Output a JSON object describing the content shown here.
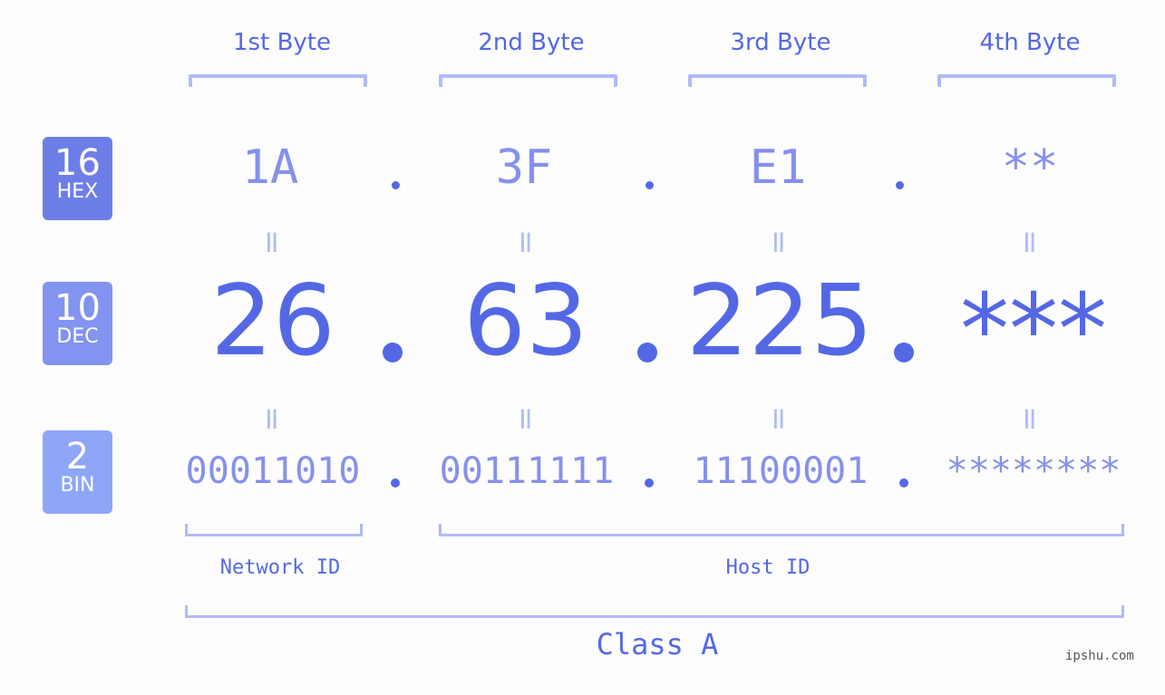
{
  "bytes": [
    {
      "label": "1st Byte",
      "hex": "1A",
      "dec": "26",
      "bin": "00011010"
    },
    {
      "label": "2nd Byte",
      "hex": "3F",
      "dec": "63",
      "bin": "00111111"
    },
    {
      "label": "3rd Byte",
      "hex": "E1",
      "dec": "225",
      "bin": "11100001"
    },
    {
      "label": "4th Byte",
      "hex": "**",
      "dec": "***",
      "bin": "********"
    }
  ],
  "badges": {
    "hex": {
      "num": "16",
      "unit": "HEX",
      "color": "#6e7ee9"
    },
    "dec": {
      "num": "10",
      "unit": "DEC",
      "color": "#8293f0"
    },
    "bin": {
      "num": "2",
      "unit": "BIN",
      "color": "#8ea6f8"
    }
  },
  "equals_symbol": "=",
  "network_id_label": "Network ID",
  "host_id_label": "Host ID",
  "class_label": "Class A",
  "watermark": "ipshu.com",
  "colors": {
    "primary": "#5468e6",
    "secondary": "#8690ec",
    "bracket": "#b2bbf6",
    "background": "#fcfdfc"
  }
}
